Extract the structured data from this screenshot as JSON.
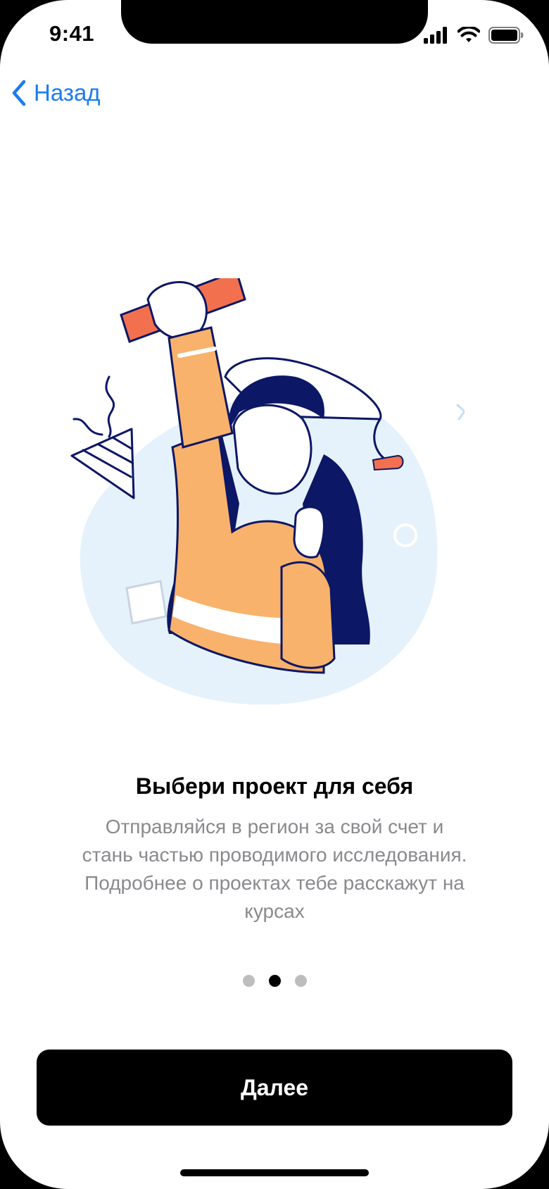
{
  "status_bar": {
    "time": "9:41"
  },
  "nav": {
    "back_label": "Назад"
  },
  "onboarding": {
    "title": "Выбери проект для себя",
    "description": "Отправляйся в регион за свой счет и стань частью проводимого исследования. Подробнее о проектах тебе расскажут на курсах",
    "page_count": 3,
    "active_page": 2
  },
  "cta": {
    "label": "Далее"
  },
  "colors": {
    "accent": "#1a7cf0",
    "illustration_orange": "#f9b26b",
    "illustration_red": "#f3704f",
    "illustration_navy": "#0c1766",
    "illustration_bg": "#e6f2fb"
  }
}
